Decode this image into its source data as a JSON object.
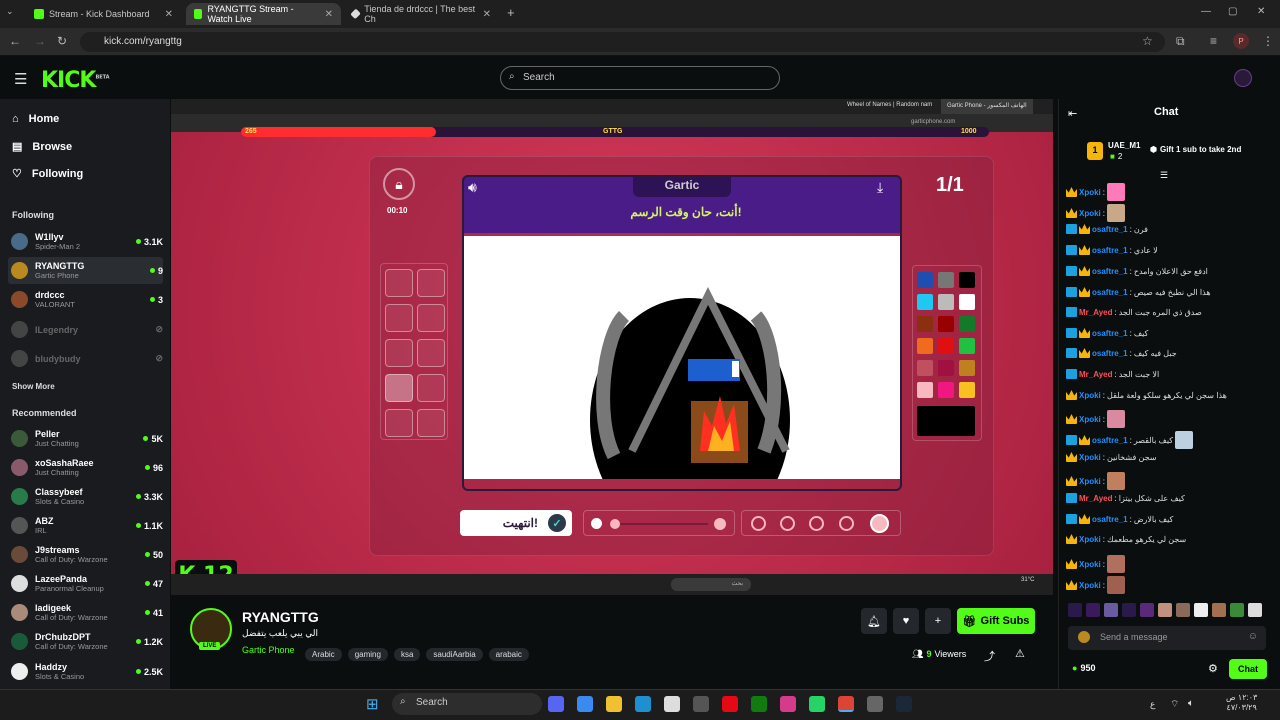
{
  "browser": {
    "tabs": [
      {
        "title": "Stream - Kick Dashboard",
        "active": false
      },
      {
        "title": "RYANGTTG Stream - Watch Live",
        "active": true
      },
      {
        "title": "Tienda de drdccc | The best Ch",
        "active": false
      }
    ],
    "url": "kick.com/ryangttg",
    "profile_letter": "P"
  },
  "kick": {
    "logo": "KICK",
    "logo_badge": "BETA",
    "search_placeholder": "Search",
    "nav": [
      {
        "label": "Home",
        "icon": "home-icon"
      },
      {
        "label": "Browse",
        "icon": "browse-icon"
      },
      {
        "label": "Following",
        "icon": "heart-icon"
      }
    ],
    "following_header": "Following",
    "following": [
      {
        "name": "W1llyv",
        "sub": "Spider-Man 2",
        "viewers": "3.1K",
        "live": true
      },
      {
        "name": "RYANGTTG",
        "sub": "Gartic Phone",
        "viewers": "9",
        "live": true
      },
      {
        "name": "drdccc",
        "sub": "VALORANT",
        "viewers": "3",
        "live": true
      },
      {
        "name": "ILegendry",
        "sub": "",
        "viewers": "",
        "live": false
      },
      {
        "name": "bludybudy",
        "sub": "",
        "viewers": "",
        "live": false
      }
    ],
    "show_more": "Show More",
    "recommended_header": "Recommended",
    "recommended": [
      {
        "name": "Peller",
        "sub": "Just Chatting",
        "viewers": "5K"
      },
      {
        "name": "xoSashaRaee",
        "sub": "Just Chatting",
        "viewers": "96"
      },
      {
        "name": "Classybeef",
        "sub": "Slots & Casino",
        "viewers": "3.3K"
      },
      {
        "name": "ABZ",
        "sub": "IRL",
        "viewers": "1.1K"
      },
      {
        "name": "J9streams",
        "sub": "Call of Duty: Warzone",
        "viewers": "50"
      },
      {
        "name": "LazeePanda",
        "sub": "Paranormal Cleanup",
        "viewers": "47"
      },
      {
        "name": "ladigeek",
        "sub": "Call of Duty: Warzone",
        "viewers": "41"
      },
      {
        "name": "DrChubzDPT",
        "sub": "Call of Duty: Warzone",
        "viewers": "1.2K"
      },
      {
        "name": "Haddzy",
        "sub": "Slots & Casino",
        "viewers": "2.5K"
      }
    ]
  },
  "stream": {
    "inner_tabs": [
      "Wheel of Names | Random nam",
      "Gartic Phone - الهاتف المكسور"
    ],
    "inner_url": "garticphone.com",
    "timer_left": "265",
    "timer_center": "GTTG",
    "timer_right": "1000",
    "lock_timer": "00:10",
    "game_logo": "Gartic",
    "round": "1/1",
    "prompt": "أنت، حان وقت الرسم!",
    "done_button": "انتهيت!",
    "overlay_badge": "K 12",
    "taskbar_search": "بحث",
    "temperature": "31°C"
  },
  "channel": {
    "name": "RYANGTTG",
    "live_badge": "LIVE",
    "description": "الي يبي يلعب يتفضل",
    "category": "Gartic Phone",
    "tags": [
      "Arabic",
      "gaming",
      "ksa",
      "saudiAarbia",
      "arabaic"
    ],
    "viewers": "9",
    "viewers_label": "Viewers",
    "gift_subs": "Gift Subs"
  },
  "chat": {
    "title": "Chat",
    "leader_name": "UAE_M1",
    "leader_count": "2",
    "leader_rank": "1",
    "gift_cta": "Gift 1 sub to take 2nd",
    "messages": [
      {
        "user": "Xpoki",
        "text": "",
        "type": "u1",
        "emote": "#ff7ab8"
      },
      {
        "user": "Xpoki",
        "text": "",
        "type": "u1",
        "emote": "#c9a88a"
      },
      {
        "user": "osaftre_1",
        "text": "فرن",
        "type": "u1"
      },
      {
        "user": "osaftre_1",
        "text": "لا عادي",
        "type": "u1"
      },
      {
        "user": "osaftre_1",
        "text": "ادفع حق الاعلان وامدح",
        "type": "u1"
      },
      {
        "user": "osaftre_1",
        "text": "هذا الي نطبخ فيه صيص",
        "type": "u1"
      },
      {
        "user": "Mr_Ayed",
        "text": "صدق ذي المره جبت الجد",
        "type": "u2"
      },
      {
        "user": "osaftre_1",
        "text": "كيف",
        "type": "u1"
      },
      {
        "user": "osaftre_1",
        "text": "جبل فيه كيف",
        "type": "u1"
      },
      {
        "user": "Mr_Ayed",
        "text": "الا جبت الجد",
        "type": "u2"
      },
      {
        "user": "Xpoki",
        "text": "هذا سجن لي يكرهو سلكو ولعة ملقل",
        "type": "u1"
      },
      {
        "user": "Xpoki",
        "text": "",
        "type": "u1",
        "emote": "#d88aa0"
      },
      {
        "user": "osaftre_1",
        "text": "كيف بالقصر",
        "type": "u1",
        "emote": "#bcd0e0"
      },
      {
        "user": "Xpoki",
        "text": "سجن فشخانين",
        "type": "u1"
      },
      {
        "user": "Xpoki",
        "text": "",
        "type": "u1",
        "emote": "#c08060"
      },
      {
        "user": "Mr_Ayed",
        "text": "كيف على شكل بيتزا",
        "type": "u2"
      },
      {
        "user": "osaftre_1",
        "text": "كيف بالارض",
        "type": "u1"
      },
      {
        "user": "Xpoki",
        "text": "سجن لي يكرهو مطعمك",
        "type": "u1"
      },
      {
        "user": "Xpoki",
        "text": "",
        "type": "u1",
        "emote": "#b07060"
      },
      {
        "user": "Xpoki",
        "text": "",
        "type": "u1",
        "emote": "#a06050"
      }
    ],
    "send_placeholder": "Send a message",
    "points": "950",
    "chat_button": "Chat"
  },
  "windows": {
    "search": "Search",
    "lang": "ع",
    "time": "١٢:٠٣ ص",
    "date": "٤٧/٠٣/٢٩"
  }
}
